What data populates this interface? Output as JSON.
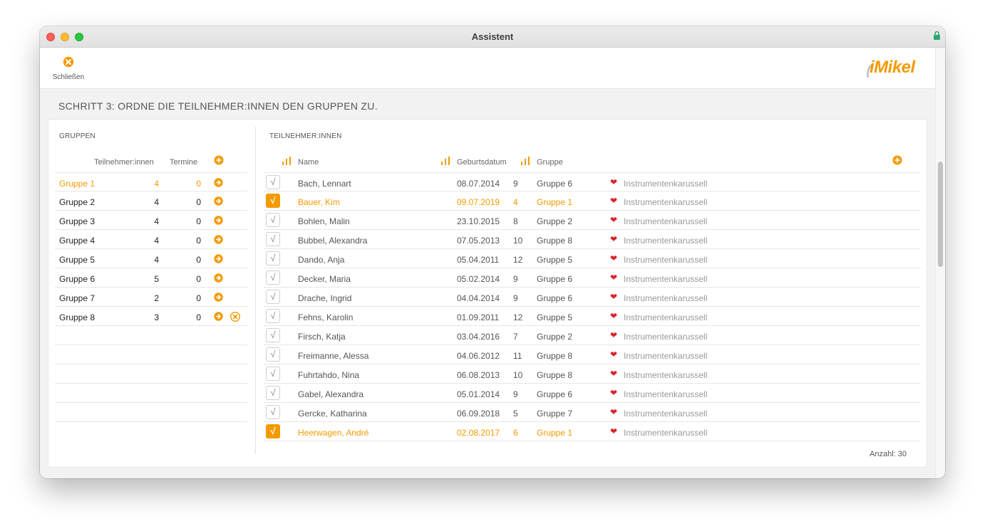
{
  "window": {
    "title": "Assistent"
  },
  "toolbar": {
    "close_label": "Schließen",
    "logo_text": "iMikel"
  },
  "step_title": "SCHRITT 3: ORDNE DIE TEILNEHMER:INNEN DEN GRUPPEN ZU.",
  "groups": {
    "section_label": "GRUPPEN",
    "col_participants": "Teilnehmer:innen",
    "col_dates": "Termine",
    "rows": [
      {
        "name": "Gruppe 1",
        "participants": "4",
        "dates": "0",
        "selected": true,
        "deletable": false
      },
      {
        "name": "Gruppe 2",
        "participants": "4",
        "dates": "0",
        "selected": false,
        "deletable": false
      },
      {
        "name": "Gruppe 3",
        "participants": "4",
        "dates": "0",
        "selected": false,
        "deletable": false
      },
      {
        "name": "Gruppe 4",
        "participants": "4",
        "dates": "0",
        "selected": false,
        "deletable": false
      },
      {
        "name": "Gruppe 5",
        "participants": "4",
        "dates": "0",
        "selected": false,
        "deletable": false
      },
      {
        "name": "Gruppe 6",
        "participants": "5",
        "dates": "0",
        "selected": false,
        "deletable": false
      },
      {
        "name": "Gruppe 7",
        "participants": "2",
        "dates": "0",
        "selected": false,
        "deletable": false
      },
      {
        "name": "Gruppe 8",
        "participants": "3",
        "dates": "0",
        "selected": false,
        "deletable": true
      }
    ]
  },
  "participants": {
    "section_label": "TEILNEHMER:INNEN",
    "col_name": "Name",
    "col_dob": "Geburtsdatum",
    "col_group": "Gruppe",
    "count_label": "Anzahl: 30",
    "rows": [
      {
        "name": "Bach, Lennart",
        "dob": "08.07.2014",
        "age": "9",
        "group": "Gruppe 6",
        "activity": "Instrumentenkarussell",
        "checked": false
      },
      {
        "name": "Bauer, Kim",
        "dob": "09.07.2019",
        "age": "4",
        "group": "Gruppe 1",
        "activity": "Instrumentenkarussell",
        "checked": true
      },
      {
        "name": "Bohlen, Malin",
        "dob": "23.10.2015",
        "age": "8",
        "group": "Gruppe 2",
        "activity": "Instrumentenkarussell",
        "checked": false
      },
      {
        "name": "Bubbel, Alexandra",
        "dob": "07.05.2013",
        "age": "10",
        "group": "Gruppe 8",
        "activity": "Instrumentenkarussell",
        "checked": false
      },
      {
        "name": "Dando, Anja",
        "dob": "05.04.2011",
        "age": "12",
        "group": "Gruppe 5",
        "activity": "Instrumentenkarussell",
        "checked": false
      },
      {
        "name": "Decker, Maria",
        "dob": "05.02.2014",
        "age": "9",
        "group": "Gruppe 6",
        "activity": "Instrumentenkarussell",
        "checked": false
      },
      {
        "name": "Drache, Ingrid",
        "dob": "04.04.2014",
        "age": "9",
        "group": "Gruppe 6",
        "activity": "Instrumentenkarussell",
        "checked": false
      },
      {
        "name": "Fehns, Karolin",
        "dob": "01.09.2011",
        "age": "12",
        "group": "Gruppe 5",
        "activity": "Instrumentenkarussell",
        "checked": false
      },
      {
        "name": "Firsch, Katja",
        "dob": "03.04.2016",
        "age": "7",
        "group": "Gruppe 2",
        "activity": "Instrumentenkarussell",
        "checked": false
      },
      {
        "name": "Freimanne, Alessa",
        "dob": "04.06.2012",
        "age": "11",
        "group": "Gruppe 8",
        "activity": "Instrumentenkarussell",
        "checked": false
      },
      {
        "name": "Fuhrtahdo, Nina",
        "dob": "06.08.2013",
        "age": "10",
        "group": "Gruppe 8",
        "activity": "Instrumentenkarussell",
        "checked": false
      },
      {
        "name": "Gabel, Alexandra",
        "dob": "05.01.2014",
        "age": "9",
        "group": "Gruppe 6",
        "activity": "Instrumentenkarussell",
        "checked": false
      },
      {
        "name": "Gercke, Katharina",
        "dob": "06.09.2018",
        "age": "5",
        "group": "Gruppe 7",
        "activity": "Instrumentenkarussell",
        "checked": false
      },
      {
        "name": "Heerwagen, André",
        "dob": "02.08.2017",
        "age": "6",
        "group": "Gruppe 1",
        "activity": "Instrumentenkarussell",
        "checked": true
      }
    ]
  },
  "colors": {
    "accent": "#f39a00",
    "heart": "#d8232a"
  },
  "icons": {
    "close": "close-circle-icon",
    "add": "plus-circle-icon",
    "arrow": "arrow-right-circle-icon",
    "sort": "bar-sort-icon",
    "heart": "heart-icon",
    "check": "check-icon"
  }
}
